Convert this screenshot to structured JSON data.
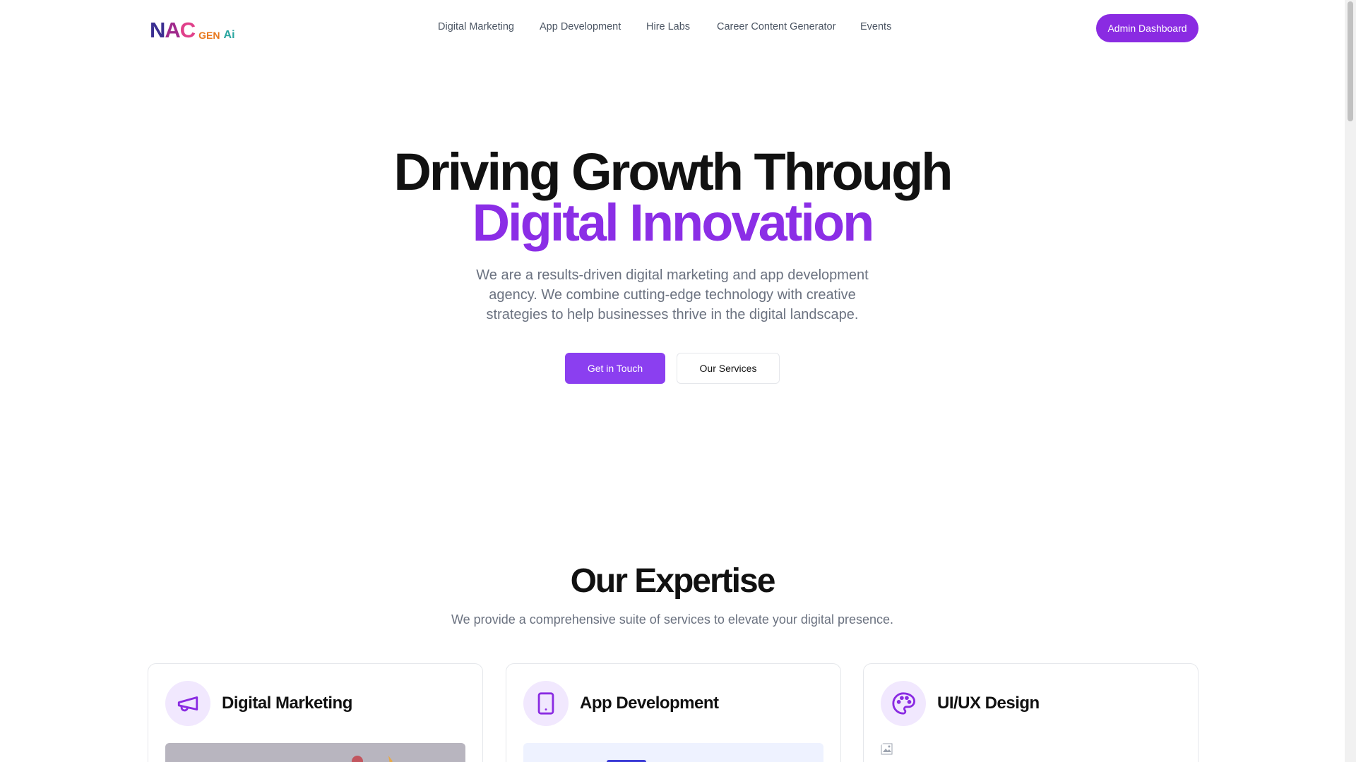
{
  "header": {
    "logo": {
      "main": "NAC",
      "gen": "GEN",
      "ai": "Ai"
    },
    "nav": [
      "Digital Marketing",
      "App Development",
      "Hire Labs",
      "Career Content Generator",
      "Events"
    ],
    "admin_label": "Admin Dashboard"
  },
  "hero": {
    "title_line1": "Driving Growth Through",
    "title_line2": "Digital Innovation",
    "subtitle": "We are a results-driven digital marketing and app development agency. We combine cutting-edge technology with creative strategies to help businesses thrive in the digital landscape.",
    "primary_cta": "Get in Touch",
    "secondary_cta": "Our Services"
  },
  "expertise": {
    "title": "Our Expertise",
    "subtitle": "We provide a comprehensive suite of services to elevate your digital presence.",
    "cards": [
      {
        "title": "Digital Marketing",
        "icon": "megaphone-icon"
      },
      {
        "title": "App Development",
        "icon": "tablet-icon"
      },
      {
        "title": "UI/UX Design",
        "icon": "palette-icon"
      }
    ]
  },
  "colors": {
    "accent": "#8a2be2",
    "accent_light": "#f1e8fe",
    "muted_text": "#6b7280"
  }
}
